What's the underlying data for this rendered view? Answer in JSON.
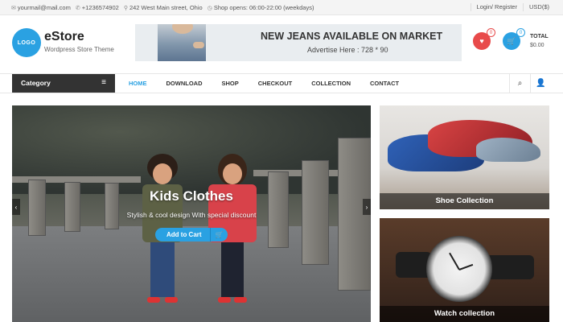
{
  "topbar": {
    "email": "yourmail@mail.com",
    "phone": "+1236574902",
    "address": "242 West Main street, Ohio",
    "hours": "Shop opens: 06:00-22:00 (weekdays)",
    "login": "Login/ Register",
    "currency": "USD($)"
  },
  "header": {
    "logo": "LOGO",
    "brand": "eStore",
    "tagline": "Wordpress Store Theme",
    "banner_line1": "NEW JEANS AVAILABLE ON MARKET",
    "banner_line2": "Advertise Here : 728 * 90",
    "wishlist_count": "0",
    "cart_count": "0",
    "total_label": "TOTAL",
    "total_value": "$0.00"
  },
  "nav": {
    "category": "Category",
    "items": [
      "HOME",
      "DOWNLOAD",
      "SHOP",
      "CHECKOUT",
      "COLLECTION",
      "CONTACT"
    ]
  },
  "hero": {
    "title": "Kids Clothes",
    "subtitle": "Stylish & cool design With special discount",
    "button": "Add to Cart"
  },
  "cards": [
    {
      "caption": "Shoe Collection"
    },
    {
      "caption": "Watch collection"
    }
  ],
  "colors": {
    "accent": "#2aa1e2",
    "wishlist": "#e84a4a",
    "dark": "#333333"
  }
}
